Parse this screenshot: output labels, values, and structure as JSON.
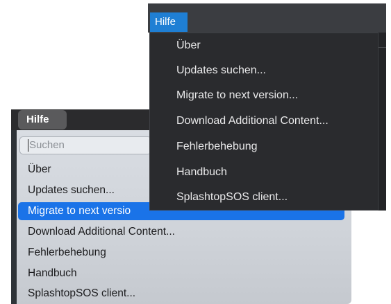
{
  "lower_menu": {
    "title": "Hilfe",
    "search_placeholder": "Suchen",
    "items": [
      {
        "label": "Über"
      },
      {
        "label": "Updates suchen..."
      },
      {
        "label": "Migrate to next version...",
        "display": "Migrate to next versio",
        "highlighted": true
      },
      {
        "label": "Download Additional Content..."
      },
      {
        "label": "Fehlerbehebung"
      },
      {
        "label": "Handbuch"
      },
      {
        "label": "SplashtopSOS client..."
      }
    ]
  },
  "upper_menu": {
    "title": "Hilfe",
    "items": [
      {
        "label": "Über"
      },
      {
        "label": "Updates suchen..."
      },
      {
        "label": "Migrate to next version..."
      },
      {
        "label": "Download Additional Content..."
      },
      {
        "label": "Fehlerbehebung"
      },
      {
        "label": "Handbuch"
      },
      {
        "label": "SplashtopSOS client..."
      }
    ]
  },
  "colors": {
    "highlight": "#1a73e8",
    "dark_title_bg": "#1f7fd4",
    "dark_menu_bg": "#2a2b2e"
  }
}
